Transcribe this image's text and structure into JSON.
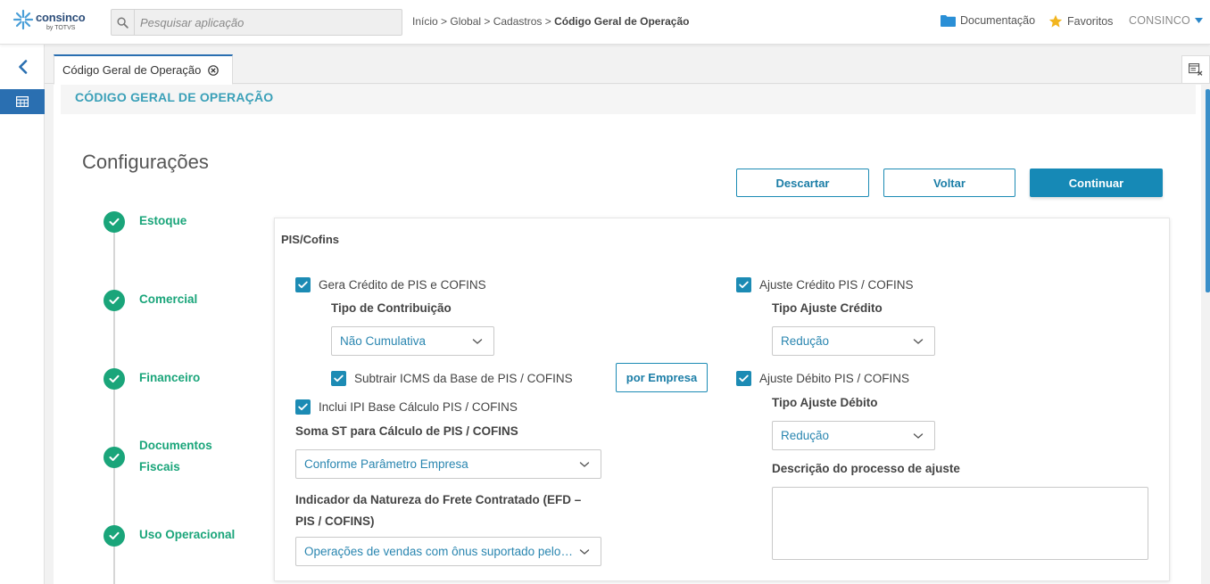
{
  "header": {
    "logo_text": "consinco",
    "logo_sub": "by TOTVS",
    "search_placeholder": "Pesquisar aplicação",
    "breadcrumb_path": "Início > Global > Cadastros > ",
    "breadcrumb_current": "Código Geral de Operação",
    "docs_label": "Documentação",
    "favorites_label": "Favoritos",
    "user_label": "CONSINCO"
  },
  "tabs": [
    {
      "label": "Código Geral de Operação"
    }
  ],
  "page": {
    "header_title": "CÓDIGO GERAL DE OPERAÇÃO",
    "section_title": "Configurações"
  },
  "actions": {
    "discard": "Descartar",
    "back": "Voltar",
    "continue": "Continuar"
  },
  "steps": [
    {
      "label": "Estoque"
    },
    {
      "label": "Comercial"
    },
    {
      "label": "Financeiro"
    },
    {
      "label_line1": "Documentos",
      "label_line2": "Fiscais"
    },
    {
      "label": "Uso Operacional"
    }
  ],
  "form": {
    "title": "PIS/Cofins",
    "gera_credito": {
      "label": "Gera Crédito de PIS e COFINS",
      "checked": true
    },
    "tipo_contribuicao": {
      "label": "Tipo de Contribuição",
      "value": "Não Cumulativa"
    },
    "subtrair_icms": {
      "label": "Subtrair ICMS da Base de PIS / COFINS",
      "checked": true
    },
    "por_empresa_button": "por Empresa",
    "inclui_ipi": {
      "label": "Inclui IPI Base Cálculo PIS / COFINS",
      "checked": true
    },
    "soma_st": {
      "label": "Soma ST para Cálculo de PIS / COFINS",
      "value": "Conforme Parâmetro Empresa"
    },
    "indicador_frete": {
      "label_line1": "Indicador da Natureza do Frete Contratado (EFD –",
      "label_line2": "PIS / COFINS)",
      "value": "Operações de vendas com ônus suportado pelo estabelecimento vendedor"
    },
    "ajuste_credito": {
      "label": "Ajuste Crédito PIS / COFINS",
      "checked": true
    },
    "tipo_ajuste_credito": {
      "label": "Tipo Ajuste Crédito",
      "value": "Redução"
    },
    "ajuste_debito": {
      "label": "Ajuste Débito PIS / COFINS",
      "checked": true
    },
    "tipo_ajuste_debito": {
      "label": "Tipo Ajuste Débito",
      "value": "Redução"
    },
    "descricao_ajuste": {
      "label": "Descrição do processo de ajuste",
      "value": ""
    }
  },
  "colors": {
    "accent": "#1c8bb4",
    "success": "#1aa57a",
    "brand_blue": "#2a6fb1",
    "section_title": "#3aa0b8"
  }
}
